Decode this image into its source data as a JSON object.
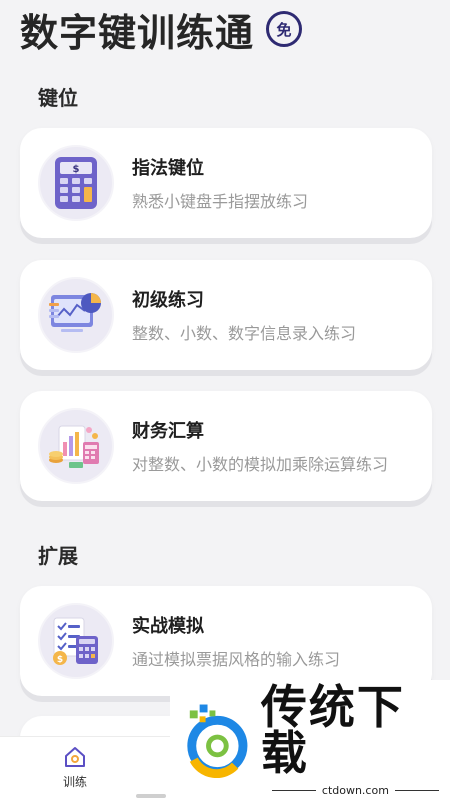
{
  "header": {
    "title": "数字键训练通",
    "badge": "免"
  },
  "sections": [
    {
      "title": "键位",
      "cards": [
        {
          "title": "指法键位",
          "subtitle": "熟悉小键盘手指摆放练习",
          "icon": "calculator-icon"
        },
        {
          "title": "初级练习",
          "subtitle": "整数、小数、数字信息录入练习",
          "icon": "dashboard-chart-icon"
        },
        {
          "title": "财务汇算",
          "subtitle": "对整数、小数的模拟加乘除运算练习",
          "icon": "finance-icon"
        }
      ]
    },
    {
      "title": "扩展",
      "cards": [
        {
          "title": "实战模拟",
          "subtitle": "通过模拟票据风格的输入练习",
          "icon": "checklist-calculator-icon"
        }
      ]
    }
  ],
  "tabbar": {
    "items": [
      {
        "label": "训练",
        "icon": "home-icon",
        "active": true
      }
    ]
  },
  "watermark": {
    "text": "传统下载",
    "url": "ctdown.com"
  },
  "colors": {
    "accent": "#2e2a72",
    "background": "#f3f3f5",
    "card": "#ffffff",
    "subtitle": "#9a9a9a"
  }
}
